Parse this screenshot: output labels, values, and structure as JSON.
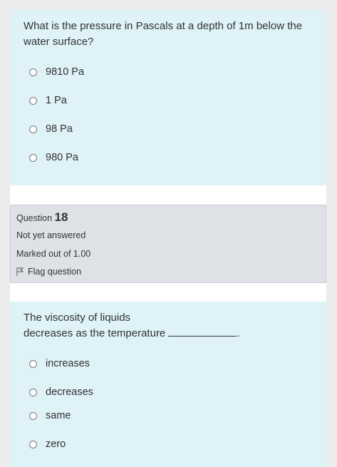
{
  "question17": {
    "text": "What is the pressure in Pascals at a depth of 1m below the water surface?",
    "options": [
      "9810 Pa",
      "1 Pa",
      "98 Pa",
      "980 Pa"
    ]
  },
  "question18": {
    "label": "Question",
    "number": "18",
    "status": "Not yet answered",
    "marks": "Marked out of 1.00",
    "flag_label": "Flag question",
    "text_line1": "The viscosity of liquids",
    "text_line2": "decreases as the temperature",
    "text_end": ".",
    "options": [
      "increases",
      "decreases",
      "same",
      "zero"
    ]
  },
  "colors": {
    "question_bg": "#def2f8",
    "info_bg": "#dee2e6",
    "page_bg": "#ececec"
  }
}
